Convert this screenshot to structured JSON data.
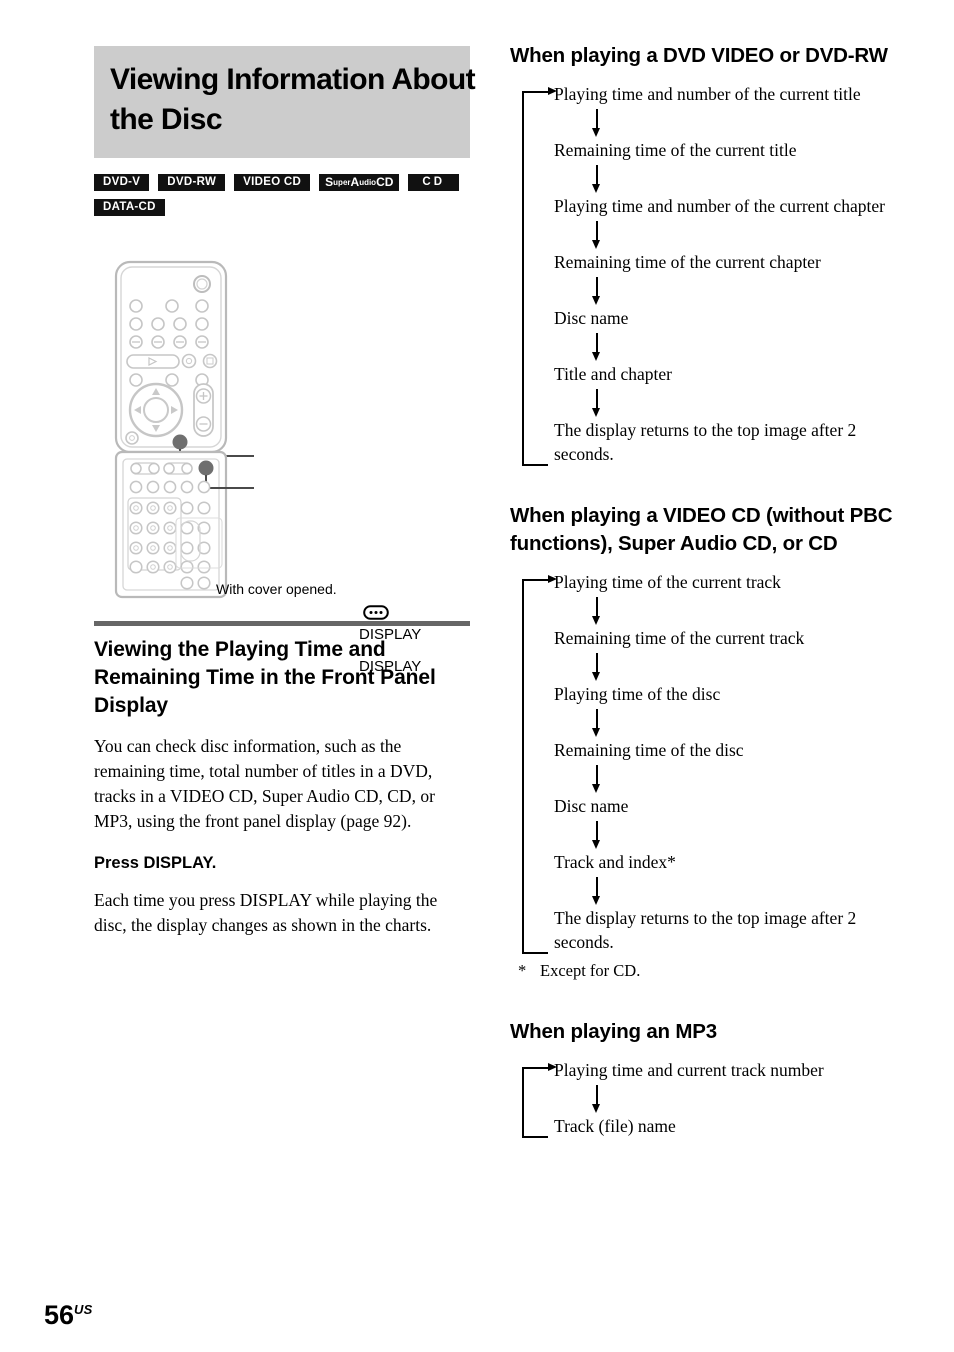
{
  "page": {
    "number": "56",
    "region_suffix": "US"
  },
  "title_block": {
    "line1": "Viewing Information About",
    "line2": "the Disc"
  },
  "disc_badges": {
    "row1": [
      {
        "id": "dvd-v",
        "label": "DVD-V"
      },
      {
        "id": "dvd-rw",
        "label": "DVD-RW"
      },
      {
        "id": "video-cd",
        "label": "VIDEO CD"
      },
      {
        "id": "super-audio-cd",
        "label": "Super Audio CD",
        "part_s": "S",
        "part_uper": "uper",
        "part_a": "A",
        "part_udio": "udio",
        "part_cd": "CD"
      },
      {
        "id": "cd",
        "label": "CD"
      }
    ],
    "row2": [
      {
        "id": "data-cd",
        "label": "DATA-CD"
      }
    ]
  },
  "figure": {
    "caption": "With cover opened.",
    "callout_top": "DISPLAY",
    "callout_bottom": "DISPLAY",
    "icon_name": "display-button-icon"
  },
  "left_section": {
    "heading": "Viewing the Playing Time and Remaining Time in the Front Panel Display",
    "paragraph": "You can check disc information, such as the remaining time, total number of titles in a DVD, tracks in a VIDEO CD, Super Audio CD, CD, or MP3, using the front panel display (page 92).",
    "bold_lead": "Press DISPLAY.",
    "paragraph2": "Each time you press DISPLAY while playing the disc, the display changes as shown in the charts."
  },
  "right_sections": [
    {
      "id": "dvd-video-dvd-rw",
      "heading": "When playing a DVD VIDEO or DVD-RW",
      "steps": [
        "Playing time and number of the current title",
        "Remaining time of the current title",
        "Playing time and number of the current chapter",
        "Remaining time of the current chapter",
        "Disc name",
        "Title and chapter",
        "The display returns to the top image after 2 seconds."
      ],
      "footnote": null
    },
    {
      "id": "video-cd-sacd-cd",
      "heading": "When playing a VIDEO CD (without PBC functions), Super Audio CD, or CD",
      "steps": [
        "Playing time of the current track",
        "Remaining time of the current track",
        "Playing time of the disc",
        "Remaining time of the disc",
        "Disc name",
        "Track and index*",
        "The display returns to the top image after 2 seconds."
      ],
      "footnote": {
        "mark": "*",
        "text": "Except for CD."
      }
    },
    {
      "id": "mp3",
      "heading": "When playing an MP3",
      "steps": [
        "Playing time and current track number",
        "Track (file) name"
      ],
      "footnote": null
    }
  ],
  "colors": {
    "title_block_bg": "#cccccc",
    "rule": "#666666",
    "badge_bg": "#111111",
    "text": "#000000"
  }
}
